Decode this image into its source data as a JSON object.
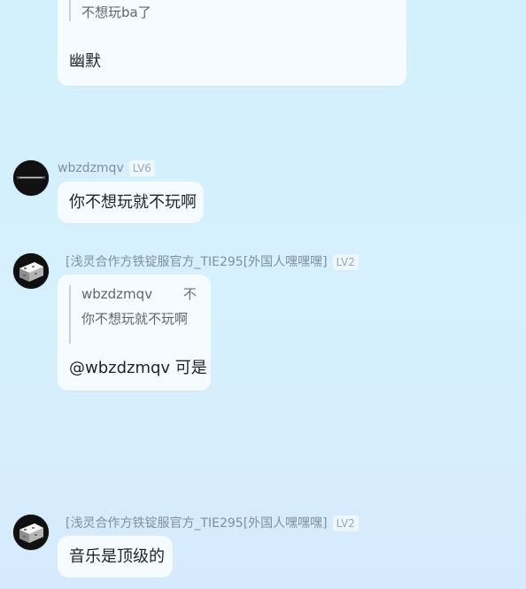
{
  "chat": {
    "messages": [
      {
        "reply": {
          "line1": "不想玩ba了"
        },
        "text": "幽默"
      },
      {
        "username": "wbzdzmqv",
        "level": "LV6",
        "text": "你不想玩就不玩啊"
      },
      {
        "username": "[浅灵合作方铁锭服官方_TIE295[外国人嘿嘿嘿]",
        "level": "LV2",
        "reply": {
          "author": "wbzdzmqv",
          "suffix": "不",
          "line2": "你不想玩就不玩啊"
        },
        "text": "@wbzdzmqv 可是"
      },
      {
        "username": "[浅灵合作方铁锭服官方_TIE295[外国人嘿嘿嘿]",
        "level": "LV2",
        "text": "音乐是顶级的"
      }
    ]
  },
  "colors": {
    "background_top": "#d2f0fd",
    "background_bottom": "#d6eafd",
    "bubble": "#f5fbff",
    "username": "#7f8fa0",
    "quote_border": "#c7d1da"
  },
  "icons": {
    "avatar_dark": "dark-banner-avatar",
    "avatar_block": "stone-block-avatar"
  }
}
